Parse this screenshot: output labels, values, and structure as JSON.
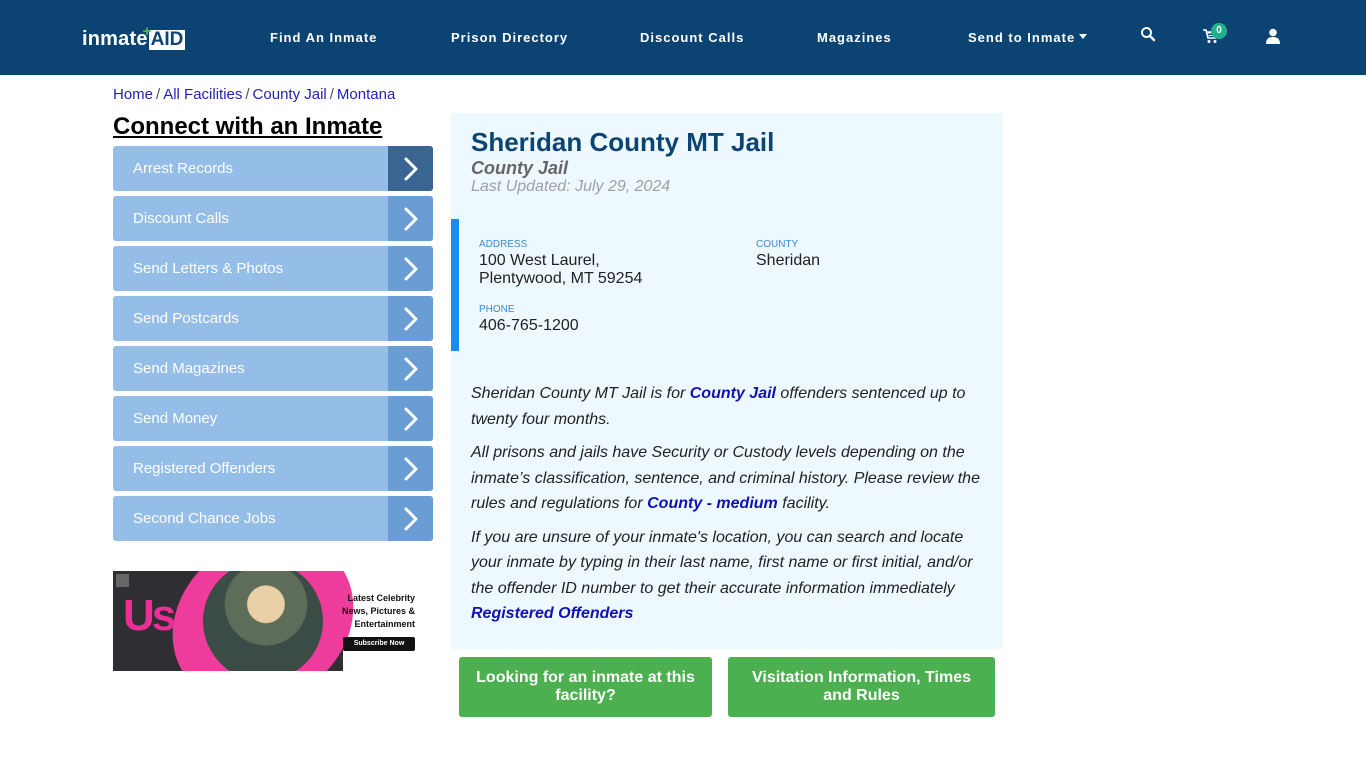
{
  "header": {
    "logo": {
      "part1": "inmate",
      "part2": "AID"
    },
    "nav": [
      {
        "label": "Find An Inmate"
      },
      {
        "label": "Prison Directory"
      },
      {
        "label": "Discount Calls"
      },
      {
        "label": "Magazines"
      },
      {
        "label": "Send to Inmate"
      }
    ],
    "cart_count": "0",
    "icons": [
      "search-icon",
      "cart-icon",
      "user-icon"
    ]
  },
  "breadcrumb": [
    {
      "label": "Home"
    },
    {
      "label": "All Facilities"
    },
    {
      "label": "County Jail"
    },
    {
      "label": "Montana"
    }
  ],
  "sidebar": {
    "title": "Connect with an Inmate",
    "items": [
      {
        "label": "Arrest Records"
      },
      {
        "label": "Discount Calls"
      },
      {
        "label": "Send Letters & Photos"
      },
      {
        "label": "Send Postcards"
      },
      {
        "label": "Send Magazines"
      },
      {
        "label": "Send Money"
      },
      {
        "label": "Registered Offenders"
      },
      {
        "label": "Second Chance Jobs"
      }
    ],
    "ad": {
      "brand": "Us",
      "tagline_1": "Latest Celebrity",
      "tagline_2": "News, Pictures &",
      "tagline_3": "Entertainment",
      "cta": "Subscribe Now"
    }
  },
  "facility": {
    "name": "Sheridan County MT Jail",
    "type": "County Jail",
    "updated": "Last Updated: July 29, 2024",
    "address_label": "ADDRESS",
    "address_line1": "100 West Laurel,",
    "address_line2": "Plentywood, MT 59254",
    "county_label": "COUNTY",
    "county": "Sheridan",
    "phone_label": "PHONE",
    "phone": "406-765-1200"
  },
  "description": {
    "p1_before": "Sheridan County MT Jail is for ",
    "p1_link": "County Jail",
    "p1_after": " offenders sentenced up to twenty four months.",
    "p2_before": "All prisons and jails have Security or Custody levels depending on the inmate’s classification, sentence, and criminal history. Please review the rules and regulations for ",
    "p2_link": "County - medium",
    "p2_after": " facility.",
    "p3": "If you are unsure of your inmate's location, you can search and locate your inmate by typing in their last name, first name or first initial, and/or the offender ID number to get their accurate information immediately",
    "p3_link": "Registered Offenders"
  },
  "buttons": {
    "find_inmate": "Looking for an inmate at this facility?",
    "visitation": "Visitation Information, Times and Rules"
  },
  "colors": {
    "header_bg": "#0b4373",
    "sidebar_item": "#94bde8",
    "panel_bg": "#eef8ff",
    "accent_bar": "#1a8cf0",
    "button_green": "#4caf50"
  }
}
